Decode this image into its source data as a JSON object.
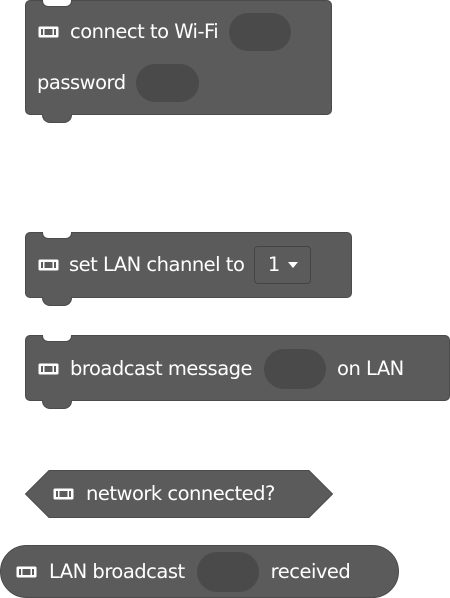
{
  "blocks": {
    "connect_wifi": {
      "label": "connect to Wi-Fi",
      "password_label": "password",
      "icon": "extension-icon"
    },
    "set_channel": {
      "label": "set LAN channel to",
      "value": "1",
      "icon": "extension-icon"
    },
    "broadcast": {
      "label": "broadcast message",
      "suffix": "on LAN",
      "icon": "extension-icon"
    },
    "network_connected": {
      "label": "network connected?",
      "icon": "extension-icon"
    },
    "lan_received": {
      "label": "LAN broadcast",
      "suffix": "received",
      "icon": "extension-icon"
    }
  },
  "colors": {
    "block": "#5b5b5b",
    "slot": "#4a4a4a",
    "text": "#ffffff"
  }
}
